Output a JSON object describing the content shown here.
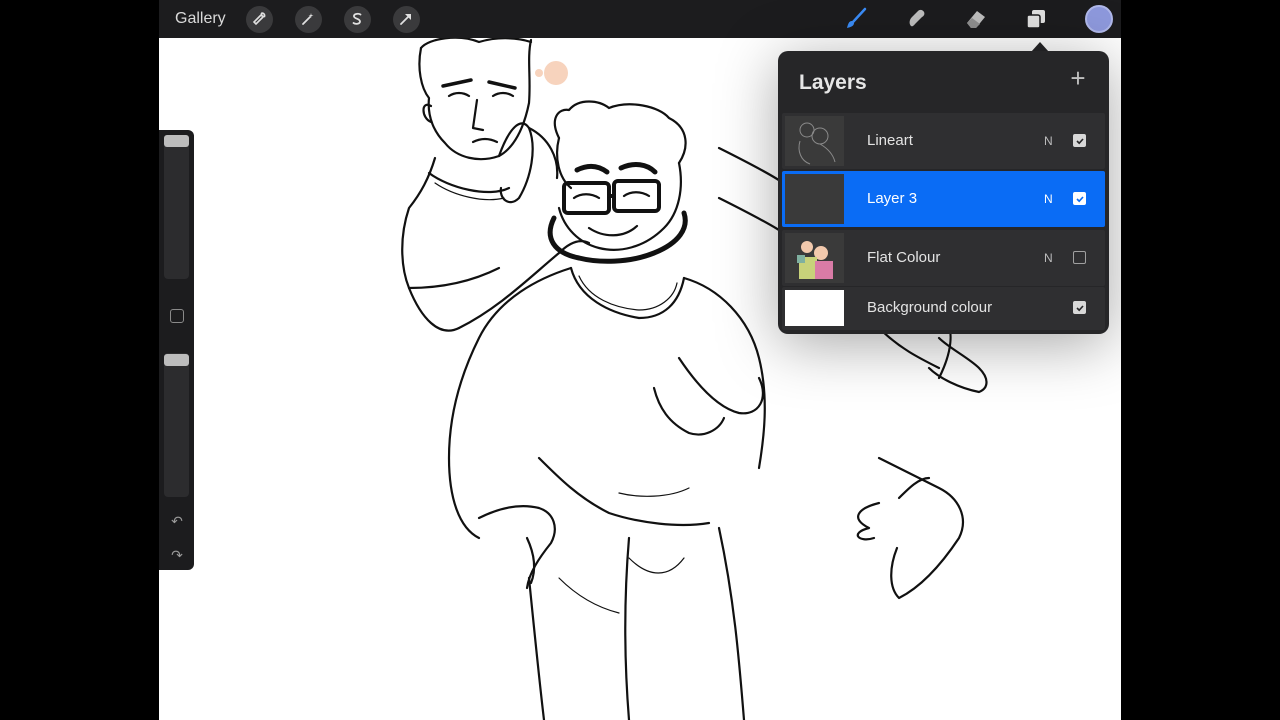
{
  "topbar": {
    "gallery_label": "Gallery",
    "left_tools": [
      "wrench-icon",
      "magic-wand-icon",
      "selection-s-icon",
      "transform-arrow-icon"
    ],
    "right_tools": [
      "brush-icon",
      "smudge-icon",
      "eraser-icon",
      "layers-icon"
    ],
    "brush_color": "#8e99dd"
  },
  "layers_panel": {
    "title": "Layers",
    "add_symbol": "+",
    "layers": [
      {
        "name": "Lineart",
        "blend": "N",
        "visible": true,
        "selected": false
      },
      {
        "name": "Layer 3",
        "blend": "N",
        "visible": true,
        "selected": true
      },
      {
        "name": "Flat Colour",
        "blend": "N",
        "visible": false,
        "selected": false
      },
      {
        "name": "Background colour",
        "blend": "",
        "visible": true,
        "selected": false
      }
    ]
  },
  "sidebar": {
    "brush_size": 0.05,
    "opacity": 0.05,
    "undo_icon": "↶",
    "redo_icon": "↷"
  },
  "colors": {
    "selected_layer": "#0a6cf5",
    "panel_bg": "#262628",
    "toolbar_bg": "#1c1c1e"
  }
}
